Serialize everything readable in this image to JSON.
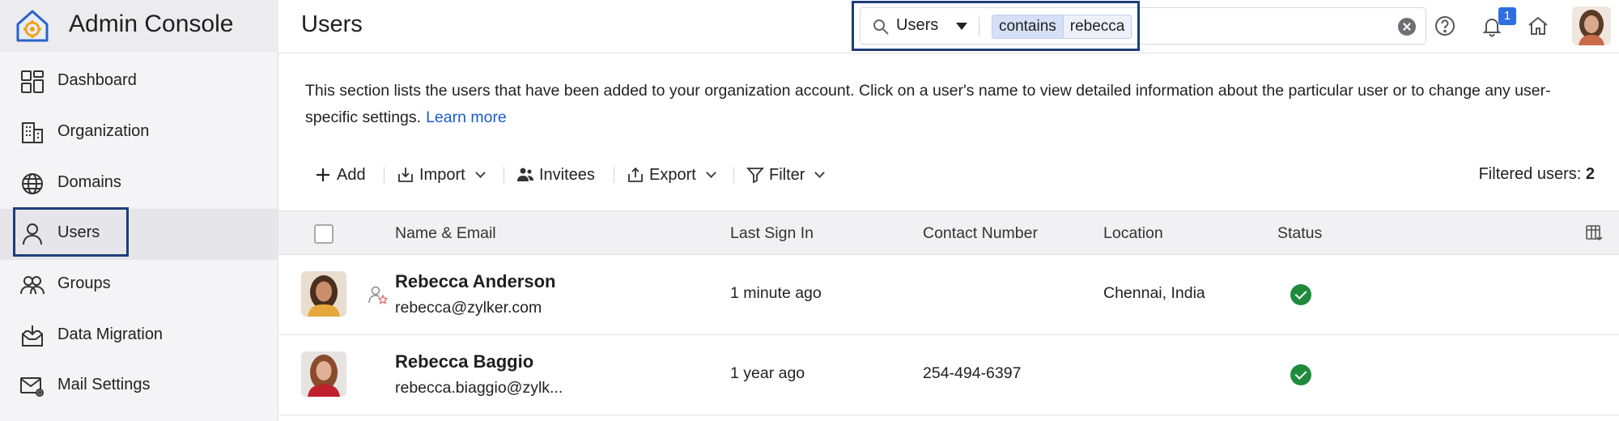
{
  "app": {
    "title": "Admin Console"
  },
  "sidebar": {
    "items": [
      {
        "label": "Dashboard",
        "icon": "dashboard-icon"
      },
      {
        "label": "Organization",
        "icon": "building-icon"
      },
      {
        "label": "Domains",
        "icon": "globe-icon"
      },
      {
        "label": "Users",
        "icon": "user-icon",
        "active": true
      },
      {
        "label": "Groups",
        "icon": "groups-icon"
      },
      {
        "label": "Data Migration",
        "icon": "inbox-download-icon"
      },
      {
        "label": "Mail Settings",
        "icon": "mail-gear-icon"
      }
    ]
  },
  "header": {
    "title": "Users",
    "search": {
      "scope": "Users",
      "operator": "contains",
      "value": "rebecca"
    },
    "notifications_count": "1"
  },
  "content": {
    "description": "This section lists the users that have been added to your organization account. Click on a user's name to view detailed information about the particular user or to change any user-specific settings.",
    "learn_more": "Learn more"
  },
  "toolbar": {
    "add": "Add",
    "import": "Import",
    "invitees": "Invitees",
    "export": "Export",
    "filter": "Filter",
    "filtered_label": "Filtered users:",
    "filtered_count": "2"
  },
  "table": {
    "columns": [
      "Name & Email",
      "Last Sign In",
      "Contact Number",
      "Location",
      "Status"
    ],
    "rows": [
      {
        "name": "Rebecca Anderson",
        "email": "rebecca@zylker.com",
        "last_sign_in": "1 minute ago",
        "contact": "",
        "location": "Chennai, India",
        "status": "active"
      },
      {
        "name": "Rebecca Baggio",
        "email": "rebecca.biaggio@zylk...",
        "last_sign_in": "1 year ago",
        "contact": "254-494-6397",
        "location": "",
        "status": "active"
      }
    ]
  },
  "colors": {
    "accent": "#1a5bcf",
    "highlight_border": "#1e3d7a",
    "status_ok": "#1f8b3a",
    "badge": "#2f6ee0"
  }
}
